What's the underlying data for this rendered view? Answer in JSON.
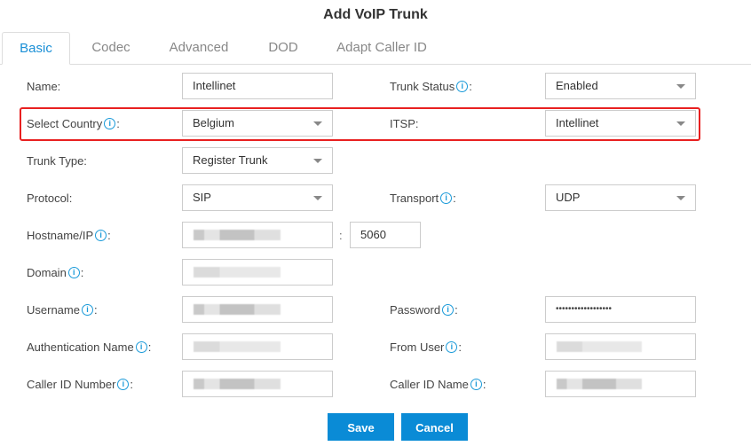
{
  "dialog": {
    "title": "Add VoIP Trunk"
  },
  "tabs": [
    {
      "label": "Basic",
      "active": true
    },
    {
      "label": "Codec",
      "active": false
    },
    {
      "label": "Advanced",
      "active": false
    },
    {
      "label": "DOD",
      "active": false
    },
    {
      "label": "Adapt Caller ID",
      "active": false
    }
  ],
  "form": {
    "name": {
      "label": "Name:",
      "value": "Intellinet"
    },
    "trunk_status": {
      "label": "Trunk Status",
      "suffix": ":",
      "value": "Enabled"
    },
    "select_country": {
      "label": "Select Country",
      "suffix": ":",
      "value": "Belgium"
    },
    "itsp": {
      "label": "ITSP:",
      "value": "Intellinet"
    },
    "trunk_type": {
      "label": "Trunk Type:",
      "value": "Register Trunk"
    },
    "protocol": {
      "label": "Protocol:",
      "value": "SIP"
    },
    "transport": {
      "label": "Transport",
      "suffix": ":",
      "value": "UDP"
    },
    "hostname": {
      "label": "Hostname/IP",
      "suffix": ":",
      "value": "",
      "port_separator": ":",
      "port": "5060"
    },
    "domain": {
      "label": "Domain",
      "suffix": ":",
      "value": ""
    },
    "username": {
      "label": "Username",
      "suffix": ":",
      "value": ""
    },
    "password": {
      "label": "Password",
      "suffix": ":",
      "value": "••••••••••••••••••"
    },
    "auth_name": {
      "label": "Authentication Name",
      "suffix": ":",
      "value": ""
    },
    "from_user": {
      "label": "From User",
      "suffix": ":",
      "value": ""
    },
    "caller_id_number": {
      "label": "Caller ID Number",
      "suffix": ":",
      "value": ""
    },
    "caller_id_name": {
      "label": "Caller ID Name",
      "suffix": ":",
      "value": ""
    }
  },
  "icons": {
    "info": "i"
  },
  "buttons": {
    "save": "Save",
    "cancel": "Cancel"
  },
  "colors": {
    "accent": "#1a8fd6",
    "button": "#0a8bd6",
    "highlight": "#e82020",
    "info": "#1a9ad9"
  }
}
